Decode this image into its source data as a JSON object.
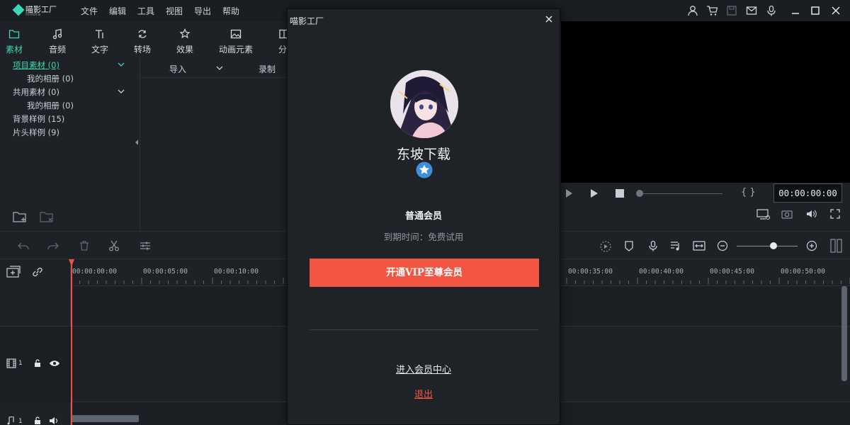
{
  "app": {
    "name": "喵影工厂",
    "sub": "filmora"
  },
  "menu": [
    "文件",
    "编辑",
    "工具",
    "视图",
    "导出",
    "帮助"
  ],
  "top_icons": [
    "user-icon",
    "cart-icon",
    "save-icon",
    "mail-icon",
    "download-icon",
    "minimize-icon",
    "maximize-icon",
    "close-icon"
  ],
  "media_tabs": [
    {
      "label": "素材",
      "icon": "folder-icon",
      "active": true
    },
    {
      "label": "音频",
      "icon": "music-icon"
    },
    {
      "label": "文字",
      "icon": "text-icon"
    },
    {
      "label": "转场",
      "icon": "transition-icon"
    },
    {
      "label": "效果",
      "icon": "effects-icon"
    },
    {
      "label": "动画元素",
      "icon": "image-icon"
    },
    {
      "label": "分",
      "icon": "split-icon"
    }
  ],
  "tree": [
    {
      "label": "项目素材 (0)",
      "level": 0,
      "active": true,
      "chevron": true
    },
    {
      "label": "我的相册 (0)",
      "level": 1
    },
    {
      "label": "共用素材 (0)",
      "level": 0,
      "chevron": true
    },
    {
      "label": "我的相册 (0)",
      "level": 1
    },
    {
      "label": "背景样例 (15)",
      "level": 0
    },
    {
      "label": "片头样例 (9)",
      "level": 0
    }
  ],
  "media_header": {
    "import": "导入",
    "record": "录制"
  },
  "player": {
    "timecode": "00:00:00:00",
    "brackets": "{  }"
  },
  "ruler_ticks": [
    "00:00:00:00",
    "00:00:05:00",
    "00:00:10:00",
    "00:00:35:00",
    "00:00:40:00",
    "00:00:45:00",
    "00:00:50:00"
  ],
  "tracks": {
    "video_num": "1",
    "audio_num": "1"
  },
  "dialog": {
    "title": "喵影工厂",
    "username": "东坡下载",
    "member_level": "普通会员",
    "expire": "到期时间：免费试用",
    "vip_button": "开通VIP至尊会员",
    "member_center": "进入会员中心",
    "logout": "退出"
  },
  "colors": {
    "accent": "#3dd6b6",
    "danger": "#f25643",
    "playhead": "#e8534a",
    "bg": "#1e2227"
  }
}
